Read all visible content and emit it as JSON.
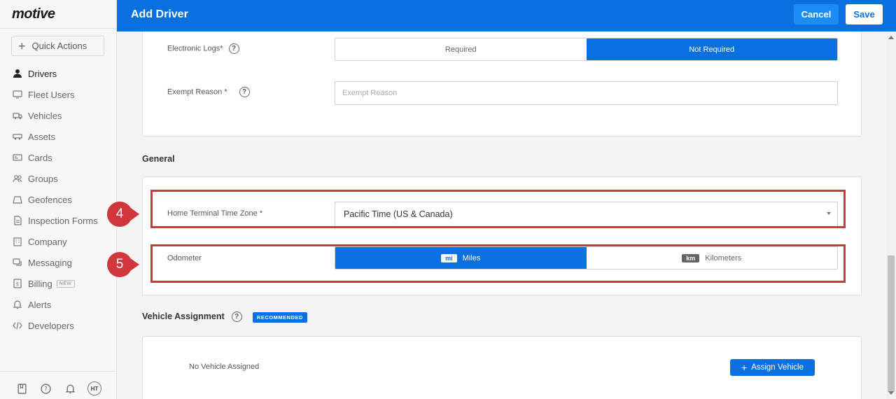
{
  "app": {
    "logo": "motive"
  },
  "sidebar": {
    "quick_actions": "Quick Actions",
    "items": [
      {
        "label": "Drivers",
        "icon": "person-icon",
        "active": true
      },
      {
        "label": "Fleet Users",
        "icon": "monitor-icon"
      },
      {
        "label": "Vehicles",
        "icon": "truck-icon"
      },
      {
        "label": "Assets",
        "icon": "trailer-icon"
      },
      {
        "label": "Cards",
        "icon": "card-icon"
      },
      {
        "label": "Groups",
        "icon": "group-icon"
      },
      {
        "label": "Geofences",
        "icon": "geofence-icon"
      },
      {
        "label": "Inspection Forms",
        "icon": "document-icon"
      },
      {
        "label": "Company",
        "icon": "building-icon"
      },
      {
        "label": "Messaging",
        "icon": "chat-icon"
      },
      {
        "label": "Billing",
        "icon": "billing-icon",
        "badge": "NEW"
      },
      {
        "label": "Alerts",
        "icon": "bell-icon"
      },
      {
        "label": "Developers",
        "icon": "code-icon"
      }
    ],
    "footer": {
      "avatar_initials": "HT"
    }
  },
  "header": {
    "title": "Add Driver",
    "cancel_label": "Cancel",
    "save_label": "Save"
  },
  "logs": {
    "electronic_logs_label": "Electronic Logs*",
    "options": [
      "Required",
      "Not Required"
    ],
    "selected": "Not Required",
    "exempt_reason_label": "Exempt Reason *",
    "exempt_reason_placeholder": "Exempt Reason"
  },
  "general": {
    "title": "General",
    "time_zone_label": "Home Terminal Time Zone *",
    "time_zone_value": "Pacific Time (US & Canada)",
    "odometer_label": "Odometer",
    "odometer_options": [
      {
        "tag": "mi",
        "label": "Miles",
        "selected": true
      },
      {
        "tag": "km",
        "label": "Kilometers",
        "selected": false
      }
    ]
  },
  "vehicle_assignment": {
    "title": "Vehicle Assignment",
    "badge": "RECOMMENDED",
    "empty_text": "No Vehicle Assigned",
    "assign_button": "Assign Vehicle"
  },
  "annotations": {
    "step4": "4",
    "step5": "5",
    "color": "#d0373c"
  },
  "colors": {
    "primary": "#0a70df",
    "header_bg": "#0a70df",
    "annotation": "#d0373c"
  }
}
